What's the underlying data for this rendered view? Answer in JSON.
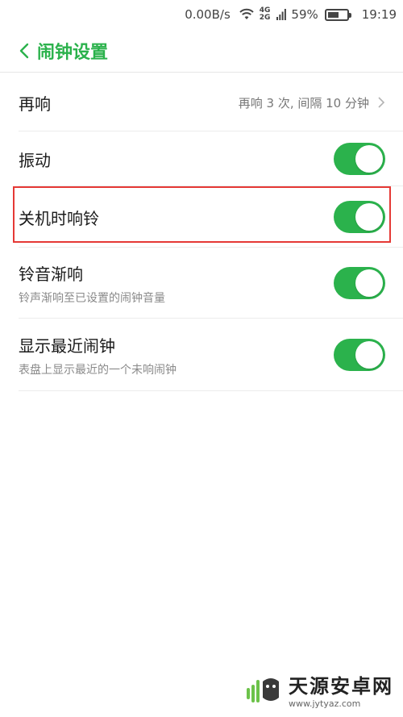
{
  "status_bar": {
    "net_speed": "0.00B/s",
    "signal_top": "4G",
    "signal_bottom": "2G",
    "battery_pct": "59%",
    "battery_level": 0.59,
    "time": "19:19"
  },
  "header": {
    "title": "闹钟设置"
  },
  "settings": {
    "snooze": {
      "label": "再响",
      "value": "再响 3 次, 间隔 10 分钟"
    },
    "vibrate": {
      "label": "振动",
      "enabled": true
    },
    "ring_when_off": {
      "label": "关机时响铃",
      "enabled": true
    },
    "fade_in": {
      "label": "铃音渐响",
      "desc": "铃声渐响至已设置的闹钟音量",
      "enabled": true
    },
    "show_next": {
      "label": "显示最近闹钟",
      "desc": "表盘上显示最近的一个未响闹钟",
      "enabled": true
    }
  },
  "colors": {
    "accent": "#2bb24c",
    "highlight": "#e53935"
  },
  "watermark": {
    "name": "天源安卓网",
    "url": "www.jytyaz.com"
  }
}
